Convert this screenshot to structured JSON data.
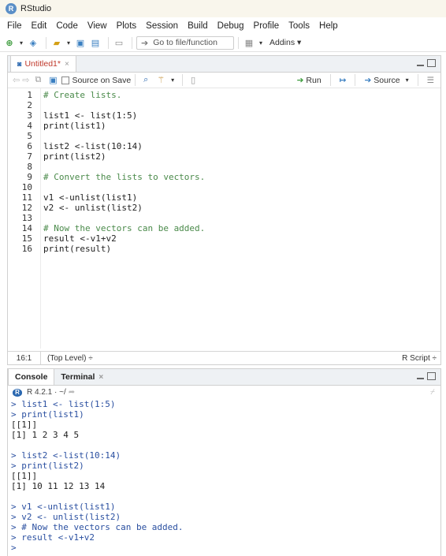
{
  "window": {
    "title": "RStudio",
    "logo_letter": "R"
  },
  "menu": [
    "File",
    "Edit",
    "Code",
    "View",
    "Plots",
    "Session",
    "Build",
    "Debug",
    "Profile",
    "Tools",
    "Help"
  ],
  "toolbar": {
    "goto_placeholder": "Go to file/function",
    "addins_label": "Addins ▾"
  },
  "editor": {
    "tab_label": "Untitled1*",
    "source_on_save_label": "Source on Save",
    "run_label": "Run",
    "source_label": "Source",
    "lines": [
      {
        "n": "1",
        "text": "# Create lists.",
        "kind": "comment"
      },
      {
        "n": "2",
        "text": "",
        "kind": "code"
      },
      {
        "n": "3",
        "text": "list1 <- list(1:5)",
        "kind": "code"
      },
      {
        "n": "4",
        "text": "print(list1)",
        "kind": "code"
      },
      {
        "n": "5",
        "text": "",
        "kind": "code"
      },
      {
        "n": "6",
        "text": "list2 <-list(10:14)",
        "kind": "code"
      },
      {
        "n": "7",
        "text": "print(list2)",
        "kind": "code"
      },
      {
        "n": "8",
        "text": "",
        "kind": "code"
      },
      {
        "n": "9",
        "text": "# Convert the lists to vectors.",
        "kind": "comment"
      },
      {
        "n": "10",
        "text": "",
        "kind": "code"
      },
      {
        "n": "11",
        "text": "v1 <-unlist(list1)",
        "kind": "code"
      },
      {
        "n": "12",
        "text": "v2 <- unlist(list2)",
        "kind": "code"
      },
      {
        "n": "13",
        "text": "",
        "kind": "code"
      },
      {
        "n": "14",
        "text": "# Now the vectors can be added.",
        "kind": "comment"
      },
      {
        "n": "15",
        "text": "result <-v1+v2",
        "kind": "code"
      },
      {
        "n": "16",
        "text": "print(result)",
        "kind": "code"
      }
    ],
    "status": {
      "position": "16:1",
      "scope": "(Top Level) ÷",
      "filetype": "R Script ÷"
    }
  },
  "console": {
    "tab_console": "Console",
    "tab_terminal": "Terminal",
    "r_version": "R 4.2.1 · ~/",
    "output": [
      {
        "text": "> list1 <- list(1:5)",
        "kind": "input"
      },
      {
        "text": "> print(list1)",
        "kind": "input"
      },
      {
        "text": "[[1]]",
        "kind": "output"
      },
      {
        "text": "[1] 1 2 3 4 5",
        "kind": "output"
      },
      {
        "text": "",
        "kind": "output"
      },
      {
        "text": "> list2 <-list(10:14)",
        "kind": "input"
      },
      {
        "text": "> print(list2)",
        "kind": "input"
      },
      {
        "text": "[[1]]",
        "kind": "output"
      },
      {
        "text": "[1] 10 11 12 13 14",
        "kind": "output"
      },
      {
        "text": "",
        "kind": "output"
      },
      {
        "text": "> v1 <-unlist(list1)",
        "kind": "input"
      },
      {
        "text": "> v2 <- unlist(list2)",
        "kind": "input"
      },
      {
        "text": "> # Now the vectors can be added.",
        "kind": "input"
      },
      {
        "text": "> result <-v1+v2",
        "kind": "input"
      },
      {
        "text": ">",
        "kind": "input"
      }
    ]
  }
}
